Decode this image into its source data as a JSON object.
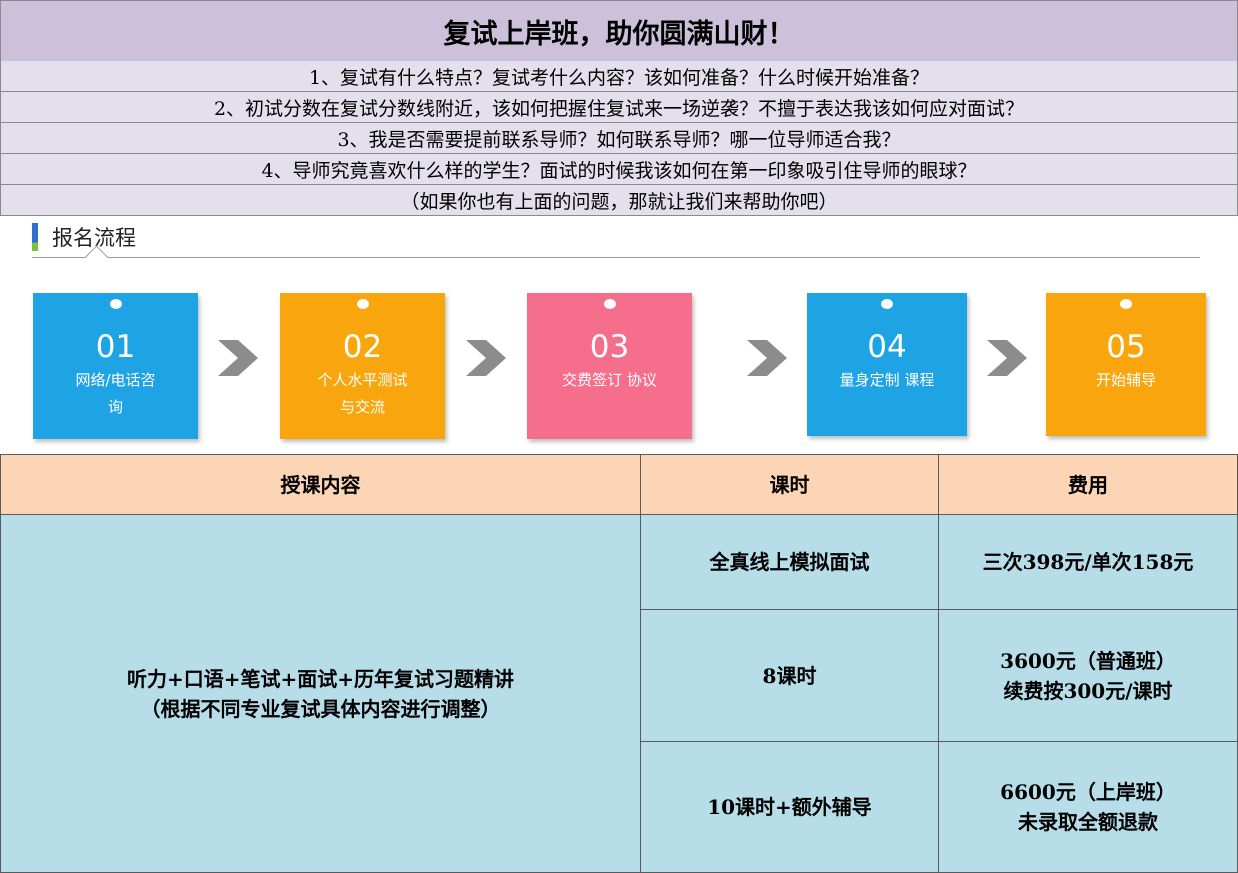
{
  "title": "复试上岸班，助你圆满山财！",
  "questions": [
    "1、复试有什么特点？复试考什么内容？该如何准备？什么时候开始准备？",
    "2、初试分数在复试分数线附近，该如何把握住复试来一场逆袭？不擅于表达我该如何应对面试？",
    "3、我是否需要提前联系导师？如何联系导师？哪一位导师适合我？",
    "4、导师究竟喜欢什么样的学生？面试的时候我该如何在第一印象吸引住导师的眼球？",
    "（如果你也有上面的问题，那就让我们来帮助你吧）"
  ],
  "process": {
    "title": "报名流程",
    "steps": [
      {
        "num": "01",
        "line1": "网络/电话咨",
        "line2": "询",
        "color": "#1ea3e4"
      },
      {
        "num": "02",
        "line1": "个人水平测试",
        "line2": "与交流",
        "color": "#f9a50e"
      },
      {
        "num": "03",
        "line1": "交费签订 协议",
        "line2": "",
        "color": "#f56e8c"
      },
      {
        "num": "04",
        "line1": "量身定制 课程",
        "line2": "",
        "color": "#1ea3e4"
      },
      {
        "num": "05",
        "line1": "开始辅导",
        "line2": "",
        "color": "#f9a50e"
      }
    ],
    "arrow_color": "#8c8c8c"
  },
  "table": {
    "headers": [
      "授课内容",
      "课时",
      "费用"
    ],
    "content_line1": "听力+口语+笔试+面试+历年复试习题精讲",
    "content_line2": "（根据不同专业复试具体内容进行调整）",
    "rows": [
      {
        "hours": "全真线上模拟面试",
        "fee1": "三次398元/单次158元",
        "fee2": ""
      },
      {
        "hours": "8课时",
        "fee1": "3600元（普通班）",
        "fee2": "续费按300元/课时"
      },
      {
        "hours": "10课时+额外辅导",
        "fee1": "6600元（上岸班）",
        "fee2": "未录取全额退款"
      }
    ]
  },
  "colors": {
    "title_bg": "#ccc0da",
    "question_bg": "#e4dfec",
    "header_bg": "#fbd5b5",
    "body_bg": "#b7dde8"
  }
}
